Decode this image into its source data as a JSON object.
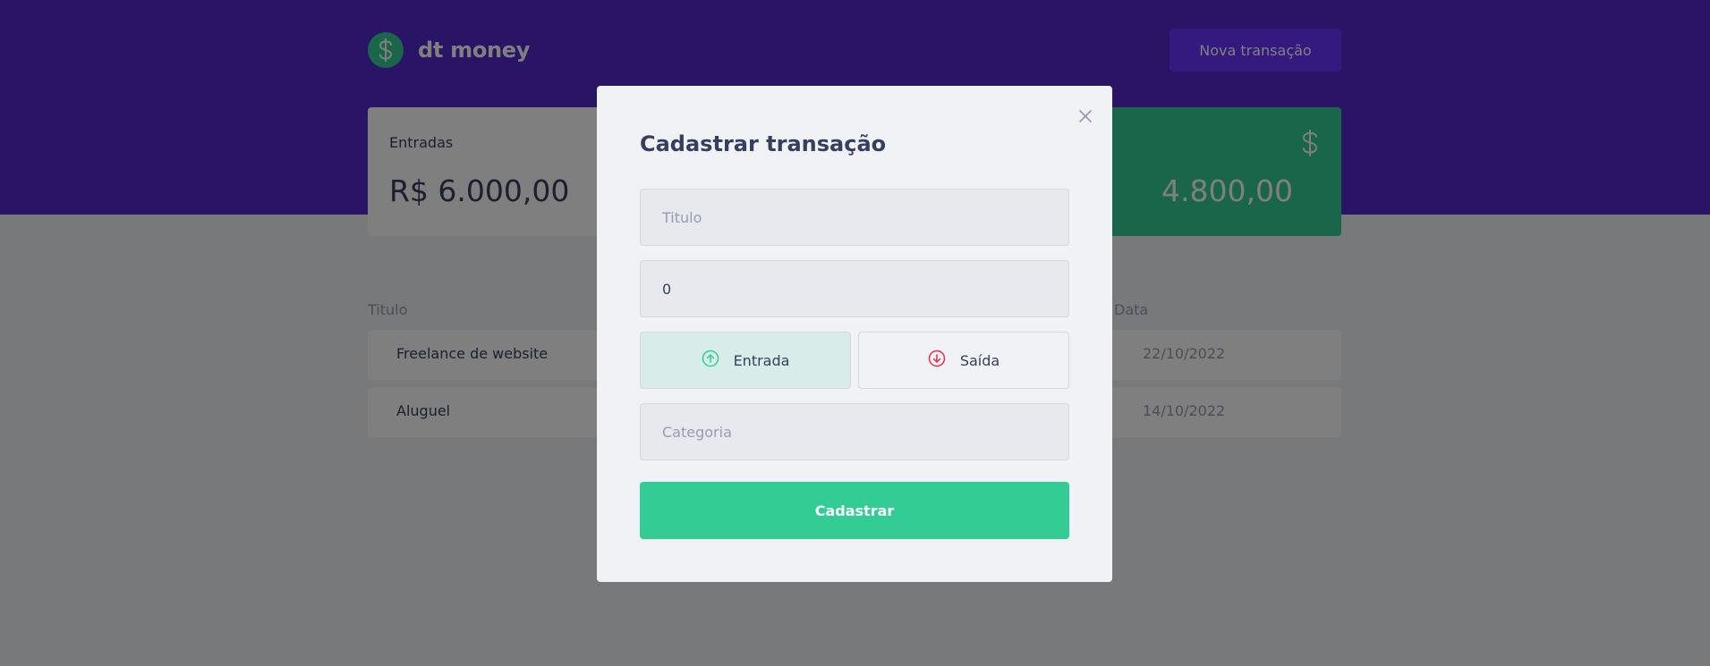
{
  "header": {
    "brand": "dt money",
    "logo_icon": "dollar-sign-icon",
    "new_transaction_label": "Nova transação"
  },
  "summary": {
    "income": {
      "label": "Entradas",
      "value": "R$ 6.000,00"
    },
    "total": {
      "value_visible": "4.800,00",
      "icon": "dollar-sign-icon"
    }
  },
  "table": {
    "headers": {
      "title": "Titulo",
      "date": "Data"
    },
    "rows": [
      {
        "title": "Freelance de website",
        "date": "22/10/2022"
      },
      {
        "title": "Aluguel",
        "date": "14/10/2022"
      }
    ]
  },
  "modal": {
    "title": "Cadastrar transação",
    "title_placeholder": "Titulo",
    "amount_value": "0",
    "type_options": [
      {
        "label": "Entrada",
        "icon": "arrow-circle-up-icon",
        "color": "#33cc95",
        "selected": true
      },
      {
        "label": "Saída",
        "icon": "arrow-circle-down-icon",
        "color": "#e52e4d",
        "selected": false
      }
    ],
    "category_placeholder": "Categoria",
    "submit_label": "Cadastrar",
    "close_icon": "close-icon"
  },
  "colors": {
    "primary": "#5429cc",
    "primary_light": "#6933ff",
    "green": "#33cc95",
    "red": "#e52e4d",
    "background": "#f0f2f5",
    "text_title": "#363f5f",
    "text_body": "#969cb3"
  }
}
